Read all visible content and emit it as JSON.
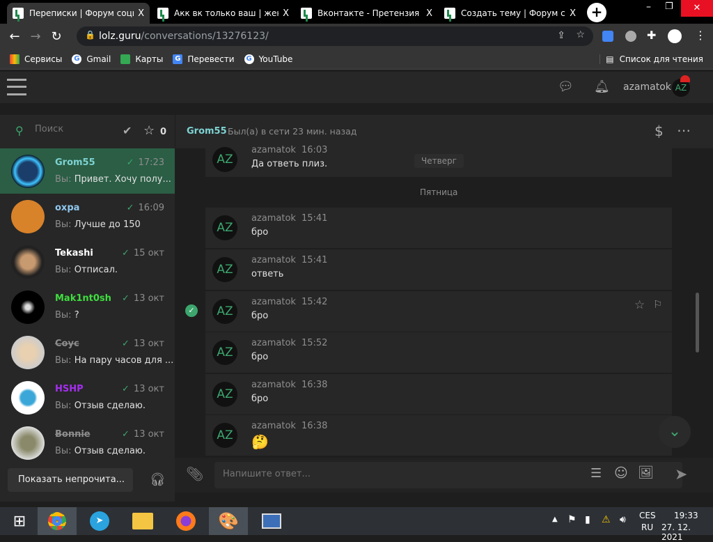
{
  "browser": {
    "tabs": [
      {
        "title": "Переписки | Форум социа",
        "active": true
      },
      {
        "title": "Акк вк только ваш | женс"
      },
      {
        "title": "Вконтакте - Претензия к С"
      },
      {
        "title": "Создать тему | Форум соц"
      }
    ],
    "close": "X",
    "new_tab": "+",
    "url_domain": "lolz.guru",
    "url_path": "/conversations/13276123/",
    "bookmarks": [
      "Сервисы",
      "Gmail",
      "Карты",
      "Перевести",
      "YouTube"
    ],
    "reading_list": "Список для чтения"
  },
  "site": {
    "username": "azamatok",
    "avatar": "AZ"
  },
  "sidebar": {
    "search_placeholder": "Поиск",
    "star_count": "0",
    "conversations": [
      {
        "name": "Grom55",
        "time": "17:23",
        "you": "Вы:",
        "preview": "Привет. Хочу полу...",
        "color": "#7ed3d3",
        "selected": true
      },
      {
        "name": "oxpa",
        "time": "16:09",
        "you": "Вы:",
        "preview": "Лучше до 150",
        "color": "#8fc8ef"
      },
      {
        "name": "Tekashi",
        "time": "15 окт",
        "you": "Вы:",
        "preview": "Отписал.",
        "color": "#ffffff"
      },
      {
        "name": "Mak1nt0sh",
        "time": "13 окт",
        "you": "Вы:",
        "preview": "?",
        "color": "#3fdc3f"
      },
      {
        "name": "Cоус",
        "time": "13 окт",
        "you": "Вы:",
        "preview": "На пару часов для ...",
        "color": "#8d8d8d",
        "strike": true
      },
      {
        "name": "HSHP",
        "time": "13 окт",
        "you": "Вы:",
        "preview": "Отзыв сделаю.",
        "color": "#a52ef0"
      },
      {
        "name": "Bonnie",
        "time": "13 окт",
        "you": "Вы:",
        "preview": "Отзыв сделаю.",
        "color": "#8d8d8d",
        "strike": true
      }
    ],
    "show_unread": "Показать непрочита..."
  },
  "chat": {
    "partner": "Grom55",
    "status": "Был(а) в сети 23 мин. назад",
    "sticky_day": "Четверг",
    "day": "Пятница",
    "messages": [
      {
        "user": "azamatok",
        "time": "16:03",
        "text": "Да ответь плиз."
      },
      {
        "user": "azamatok",
        "time": "15:41",
        "text": "бро"
      },
      {
        "user": "azamatok",
        "time": "15:41",
        "text": "ответь"
      },
      {
        "user": "azamatok",
        "time": "15:42",
        "text": "бро"
      },
      {
        "user": "azamatok",
        "time": "15:52",
        "text": "бро"
      },
      {
        "user": "azamatok",
        "time": "16:38",
        "text": "бро"
      },
      {
        "user": "azamatok",
        "time": "16:38",
        "text": "🤔"
      }
    ],
    "input_placeholder": "Напишите ответ..."
  },
  "taskbar": {
    "lang1": "CES",
    "lang2": "RU",
    "time": "19:33",
    "date": "27. 12. 2021"
  },
  "colors": {
    "accent": "#3da66e",
    "selected": "#2b5e45"
  }
}
